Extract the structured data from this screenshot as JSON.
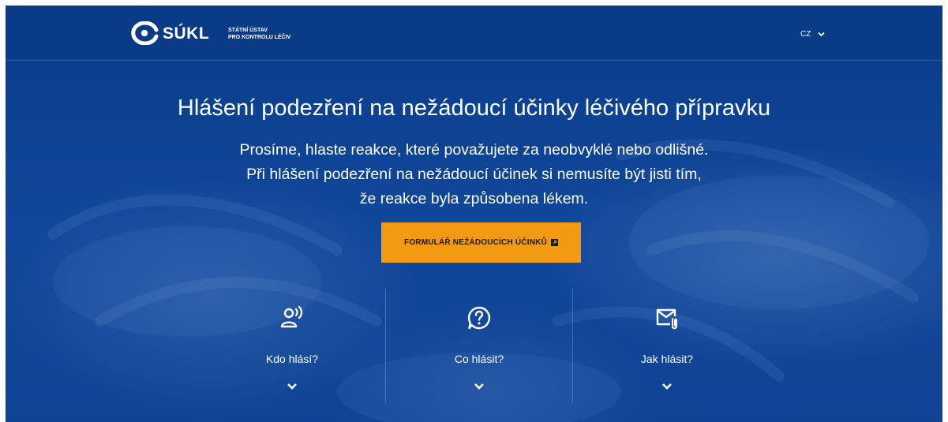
{
  "header": {
    "logo_text": "SÚKL",
    "logo_sub_line1": "STÁTNÍ ÚSTAV",
    "logo_sub_line2": "PRO KONTROLU LÉČIV",
    "language": "CZ"
  },
  "hero": {
    "title": "Hlášení podezření na nežádoucí účinky léčivého přípravku",
    "lead_line1": "Prosíme, hlaste reakce, které považujete za neobvyklé nebo odlišné.",
    "lead_line2": "Při hlášení podezření na nežádoucí účinek si nemusíte být jisti tím,",
    "lead_line3": "že reakce byla způsobena lékem.",
    "cta_label": "FORMULÁŘ NEŽÁDOUCÍCH ÚČINKŮ"
  },
  "sections": [
    {
      "label": "Kdo hlásí?",
      "icon": "person-speaking-icon"
    },
    {
      "label": "Co hlásit?",
      "icon": "question-bubble-icon"
    },
    {
      "label": "Jak hlásit?",
      "icon": "mail-attachment-icon"
    }
  ],
  "colors": {
    "brand_blue": "#0a3b86",
    "accent_orange": "#f29a12",
    "text": "#ffffff"
  }
}
